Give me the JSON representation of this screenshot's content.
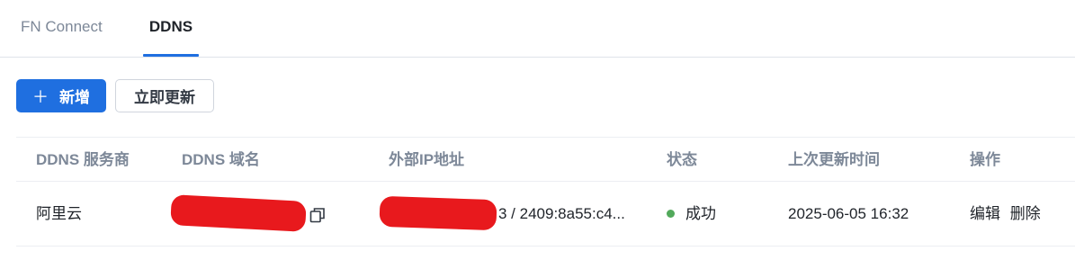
{
  "tabs": [
    {
      "label": "FN Connect"
    },
    {
      "label": "DDNS"
    }
  ],
  "toolbar": {
    "add_label": "新增",
    "update_now_label": "立即更新"
  },
  "table": {
    "columns": [
      "DDNS 服务商",
      "DDNS 域名",
      "外部IP地址",
      "状态",
      "上次更新时间",
      "操作"
    ],
    "rows": [
      {
        "provider": "阿里云",
        "domain": "",
        "ip": "3 / 2409:8a55:c4...",
        "status": "成功",
        "last_update": "2025-06-05 16:32",
        "actions": {
          "edit": "编辑",
          "delete": "删除"
        }
      }
    ]
  },
  "colors": {
    "accent": "#1f6fe0",
    "success": "#52a95b",
    "redaction": "#e8191d"
  }
}
